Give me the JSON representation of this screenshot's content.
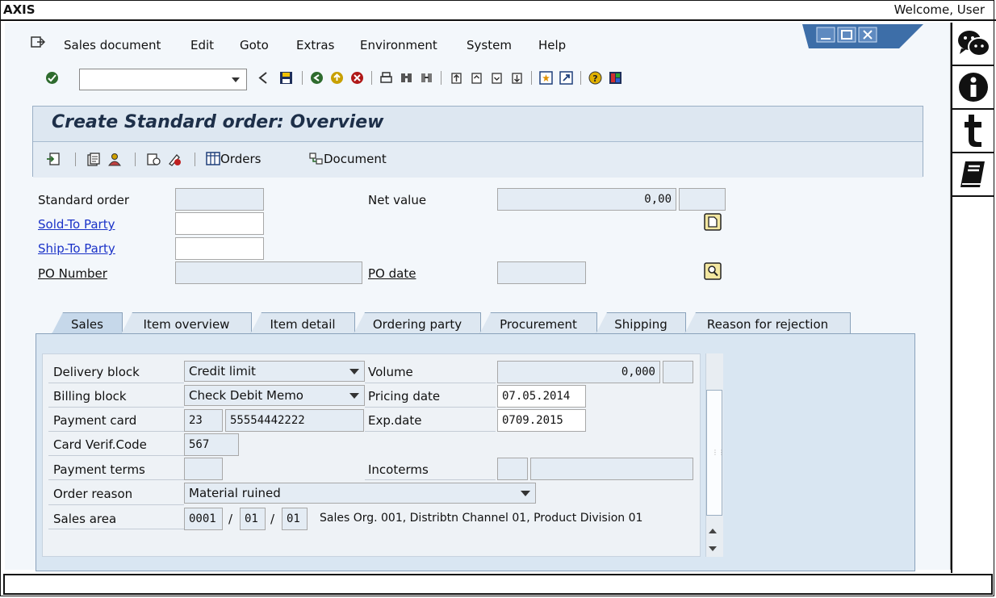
{
  "topbar": {
    "app_title": "AXIS",
    "welcome": "Welcome, User"
  },
  "menu": {
    "items": [
      "Sales document",
      "Edit",
      "Goto",
      "Extras",
      "Environment",
      "System",
      "Help"
    ]
  },
  "header": {
    "title": "Create Standard order: Overview"
  },
  "appbar": {
    "orders_label": "Orders",
    "document_label": "Document"
  },
  "form": {
    "standard_order_label": "Standard order",
    "standard_order_value": "",
    "sold_to_label": "Sold-To Party",
    "sold_to_value": "",
    "ship_to_label": "Ship-To Party",
    "ship_to_value": "",
    "po_number_label": "PO Number",
    "po_number_value": "",
    "net_value_label": "Net value",
    "net_value": "0,00",
    "currency": "",
    "po_date_label": "PO date",
    "po_date_value": ""
  },
  "tabs": [
    "Sales",
    "Item overview",
    "Item detail",
    "Ordering party",
    "Procurement",
    "Shipping",
    "Reason for rejection"
  ],
  "sales": {
    "delivery_block_label": "Delivery block",
    "delivery_block_value": "Credit limit",
    "billing_block_label": "Billing block",
    "billing_block_value": "Check Debit Memo",
    "payment_card_label": "Payment card",
    "payment_card_type": "23",
    "payment_card_number": "55554442222",
    "card_verif_label": "Card Verif.Code",
    "card_verif_value": "567",
    "payment_terms_label": "Payment terms",
    "payment_terms_value": "",
    "order_reason_label": "Order reason",
    "order_reason_value": "Material ruined",
    "sales_area_label": "Sales area",
    "sales_org": "0001",
    "distr_channel": "01",
    "division": "01",
    "sep1": "/",
    "sep2": "/",
    "sales_area_desc": "Sales Org. 001, Distribtn Channel 01, Product Division 01",
    "volume_label": "Volume",
    "volume_value": "0,000",
    "volume_unit": "",
    "pricing_date_label": "Pricing date",
    "pricing_date_value": "07.05.2014",
    "exp_date_label": "Exp.date",
    "exp_date_value": "0709.2015",
    "incoterms_label": "Incoterms",
    "incoterms_code": "",
    "incoterms_place": ""
  },
  "colors": {
    "accent_title": "#1d2f49",
    "link": "#1a32c8",
    "panel": "#dde7f1"
  }
}
